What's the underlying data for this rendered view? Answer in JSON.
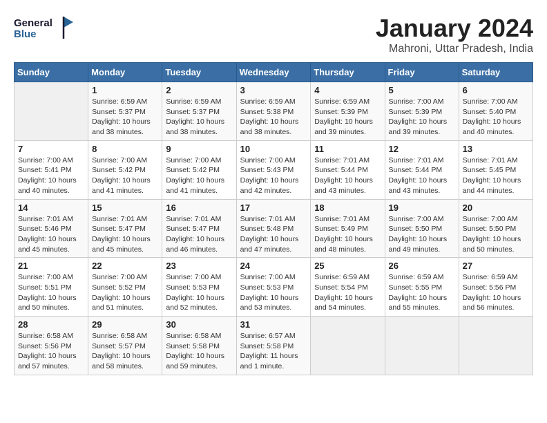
{
  "logo": {
    "text_general": "General",
    "text_blue": "Blue"
  },
  "title": "January 2024",
  "subtitle": "Mahroni, Uttar Pradesh, India",
  "headers": [
    "Sunday",
    "Monday",
    "Tuesday",
    "Wednesday",
    "Thursday",
    "Friday",
    "Saturday"
  ],
  "weeks": [
    [
      {
        "num": "",
        "info": ""
      },
      {
        "num": "1",
        "info": "Sunrise: 6:59 AM\nSunset: 5:37 PM\nDaylight: 10 hours\nand 38 minutes."
      },
      {
        "num": "2",
        "info": "Sunrise: 6:59 AM\nSunset: 5:37 PM\nDaylight: 10 hours\nand 38 minutes."
      },
      {
        "num": "3",
        "info": "Sunrise: 6:59 AM\nSunset: 5:38 PM\nDaylight: 10 hours\nand 38 minutes."
      },
      {
        "num": "4",
        "info": "Sunrise: 6:59 AM\nSunset: 5:39 PM\nDaylight: 10 hours\nand 39 minutes."
      },
      {
        "num": "5",
        "info": "Sunrise: 7:00 AM\nSunset: 5:39 PM\nDaylight: 10 hours\nand 39 minutes."
      },
      {
        "num": "6",
        "info": "Sunrise: 7:00 AM\nSunset: 5:40 PM\nDaylight: 10 hours\nand 40 minutes."
      }
    ],
    [
      {
        "num": "7",
        "info": "Sunrise: 7:00 AM\nSunset: 5:41 PM\nDaylight: 10 hours\nand 40 minutes."
      },
      {
        "num": "8",
        "info": "Sunrise: 7:00 AM\nSunset: 5:42 PM\nDaylight: 10 hours\nand 41 minutes."
      },
      {
        "num": "9",
        "info": "Sunrise: 7:00 AM\nSunset: 5:42 PM\nDaylight: 10 hours\nand 41 minutes."
      },
      {
        "num": "10",
        "info": "Sunrise: 7:00 AM\nSunset: 5:43 PM\nDaylight: 10 hours\nand 42 minutes."
      },
      {
        "num": "11",
        "info": "Sunrise: 7:01 AM\nSunset: 5:44 PM\nDaylight: 10 hours\nand 43 minutes."
      },
      {
        "num": "12",
        "info": "Sunrise: 7:01 AM\nSunset: 5:44 PM\nDaylight: 10 hours\nand 43 minutes."
      },
      {
        "num": "13",
        "info": "Sunrise: 7:01 AM\nSunset: 5:45 PM\nDaylight: 10 hours\nand 44 minutes."
      }
    ],
    [
      {
        "num": "14",
        "info": "Sunrise: 7:01 AM\nSunset: 5:46 PM\nDaylight: 10 hours\nand 45 minutes."
      },
      {
        "num": "15",
        "info": "Sunrise: 7:01 AM\nSunset: 5:47 PM\nDaylight: 10 hours\nand 45 minutes."
      },
      {
        "num": "16",
        "info": "Sunrise: 7:01 AM\nSunset: 5:47 PM\nDaylight: 10 hours\nand 46 minutes."
      },
      {
        "num": "17",
        "info": "Sunrise: 7:01 AM\nSunset: 5:48 PM\nDaylight: 10 hours\nand 47 minutes."
      },
      {
        "num": "18",
        "info": "Sunrise: 7:01 AM\nSunset: 5:49 PM\nDaylight: 10 hours\nand 48 minutes."
      },
      {
        "num": "19",
        "info": "Sunrise: 7:00 AM\nSunset: 5:50 PM\nDaylight: 10 hours\nand 49 minutes."
      },
      {
        "num": "20",
        "info": "Sunrise: 7:00 AM\nSunset: 5:50 PM\nDaylight: 10 hours\nand 50 minutes."
      }
    ],
    [
      {
        "num": "21",
        "info": "Sunrise: 7:00 AM\nSunset: 5:51 PM\nDaylight: 10 hours\nand 50 minutes."
      },
      {
        "num": "22",
        "info": "Sunrise: 7:00 AM\nSunset: 5:52 PM\nDaylight: 10 hours\nand 51 minutes."
      },
      {
        "num": "23",
        "info": "Sunrise: 7:00 AM\nSunset: 5:53 PM\nDaylight: 10 hours\nand 52 minutes."
      },
      {
        "num": "24",
        "info": "Sunrise: 7:00 AM\nSunset: 5:53 PM\nDaylight: 10 hours\nand 53 minutes."
      },
      {
        "num": "25",
        "info": "Sunrise: 6:59 AM\nSunset: 5:54 PM\nDaylight: 10 hours\nand 54 minutes."
      },
      {
        "num": "26",
        "info": "Sunrise: 6:59 AM\nSunset: 5:55 PM\nDaylight: 10 hours\nand 55 minutes."
      },
      {
        "num": "27",
        "info": "Sunrise: 6:59 AM\nSunset: 5:56 PM\nDaylight: 10 hours\nand 56 minutes."
      }
    ],
    [
      {
        "num": "28",
        "info": "Sunrise: 6:58 AM\nSunset: 5:56 PM\nDaylight: 10 hours\nand 57 minutes."
      },
      {
        "num": "29",
        "info": "Sunrise: 6:58 AM\nSunset: 5:57 PM\nDaylight: 10 hours\nand 58 minutes."
      },
      {
        "num": "30",
        "info": "Sunrise: 6:58 AM\nSunset: 5:58 PM\nDaylight: 10 hours\nand 59 minutes."
      },
      {
        "num": "31",
        "info": "Sunrise: 6:57 AM\nSunset: 5:58 PM\nDaylight: 11 hours\nand 1 minute."
      },
      {
        "num": "",
        "info": ""
      },
      {
        "num": "",
        "info": ""
      },
      {
        "num": "",
        "info": ""
      }
    ]
  ]
}
